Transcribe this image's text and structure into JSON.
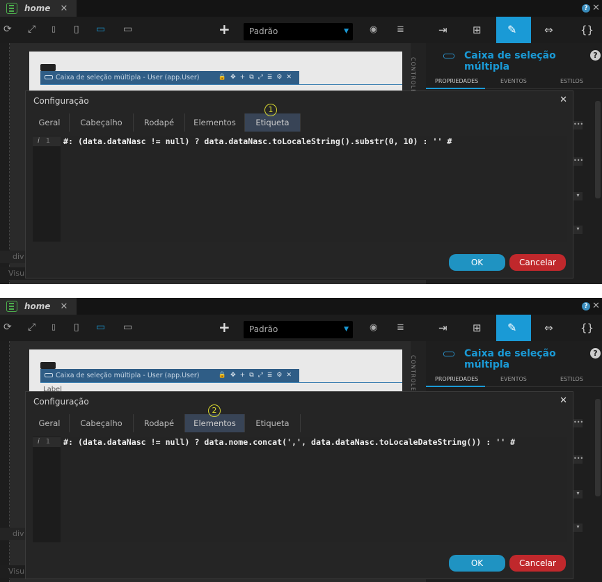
{
  "tab": {
    "name": "home",
    "close": "✕"
  },
  "toolbar": {
    "select_value": "Padrão"
  },
  "right_panel": {
    "title": "Caixa de seleção múltipla",
    "tabs": [
      "PROPRIEDADES",
      "EVENTOS",
      "ESTILOS"
    ]
  },
  "canvas": {
    "component_title": "Caixa de seleção múltipla - User (app.User)",
    "controls_label": "CONTROLE",
    "bottom_items": [
      "div",
      "Visu"
    ],
    "label_text": "Label"
  },
  "dialog": {
    "title": "Configuração",
    "tabs": [
      "Geral",
      "Cabeçalho",
      "Rodapé",
      "Elementos",
      "Etiqueta"
    ],
    "ok": "OK",
    "cancel": "Cancelar"
  },
  "screens": [
    {
      "active_tab": "Etiqueta",
      "marker": "1",
      "line_number": "1",
      "code": "#: (data.dataNasc != null) ? data.dataNasc.toLocaleString().substr(0, 10) : '' #"
    },
    {
      "active_tab": "Elementos",
      "marker": "2",
      "line_number": "1",
      "code": "#: (data.dataNasc != null) ? data.nome.concat(',', data.dataNasc.toLocaleDateString()) : '' #"
    }
  ],
  "colors": {
    "accent": "#1a9ad6",
    "ok": "#1f93c2",
    "cancel": "#c0282c",
    "marker": "#d8d830"
  }
}
